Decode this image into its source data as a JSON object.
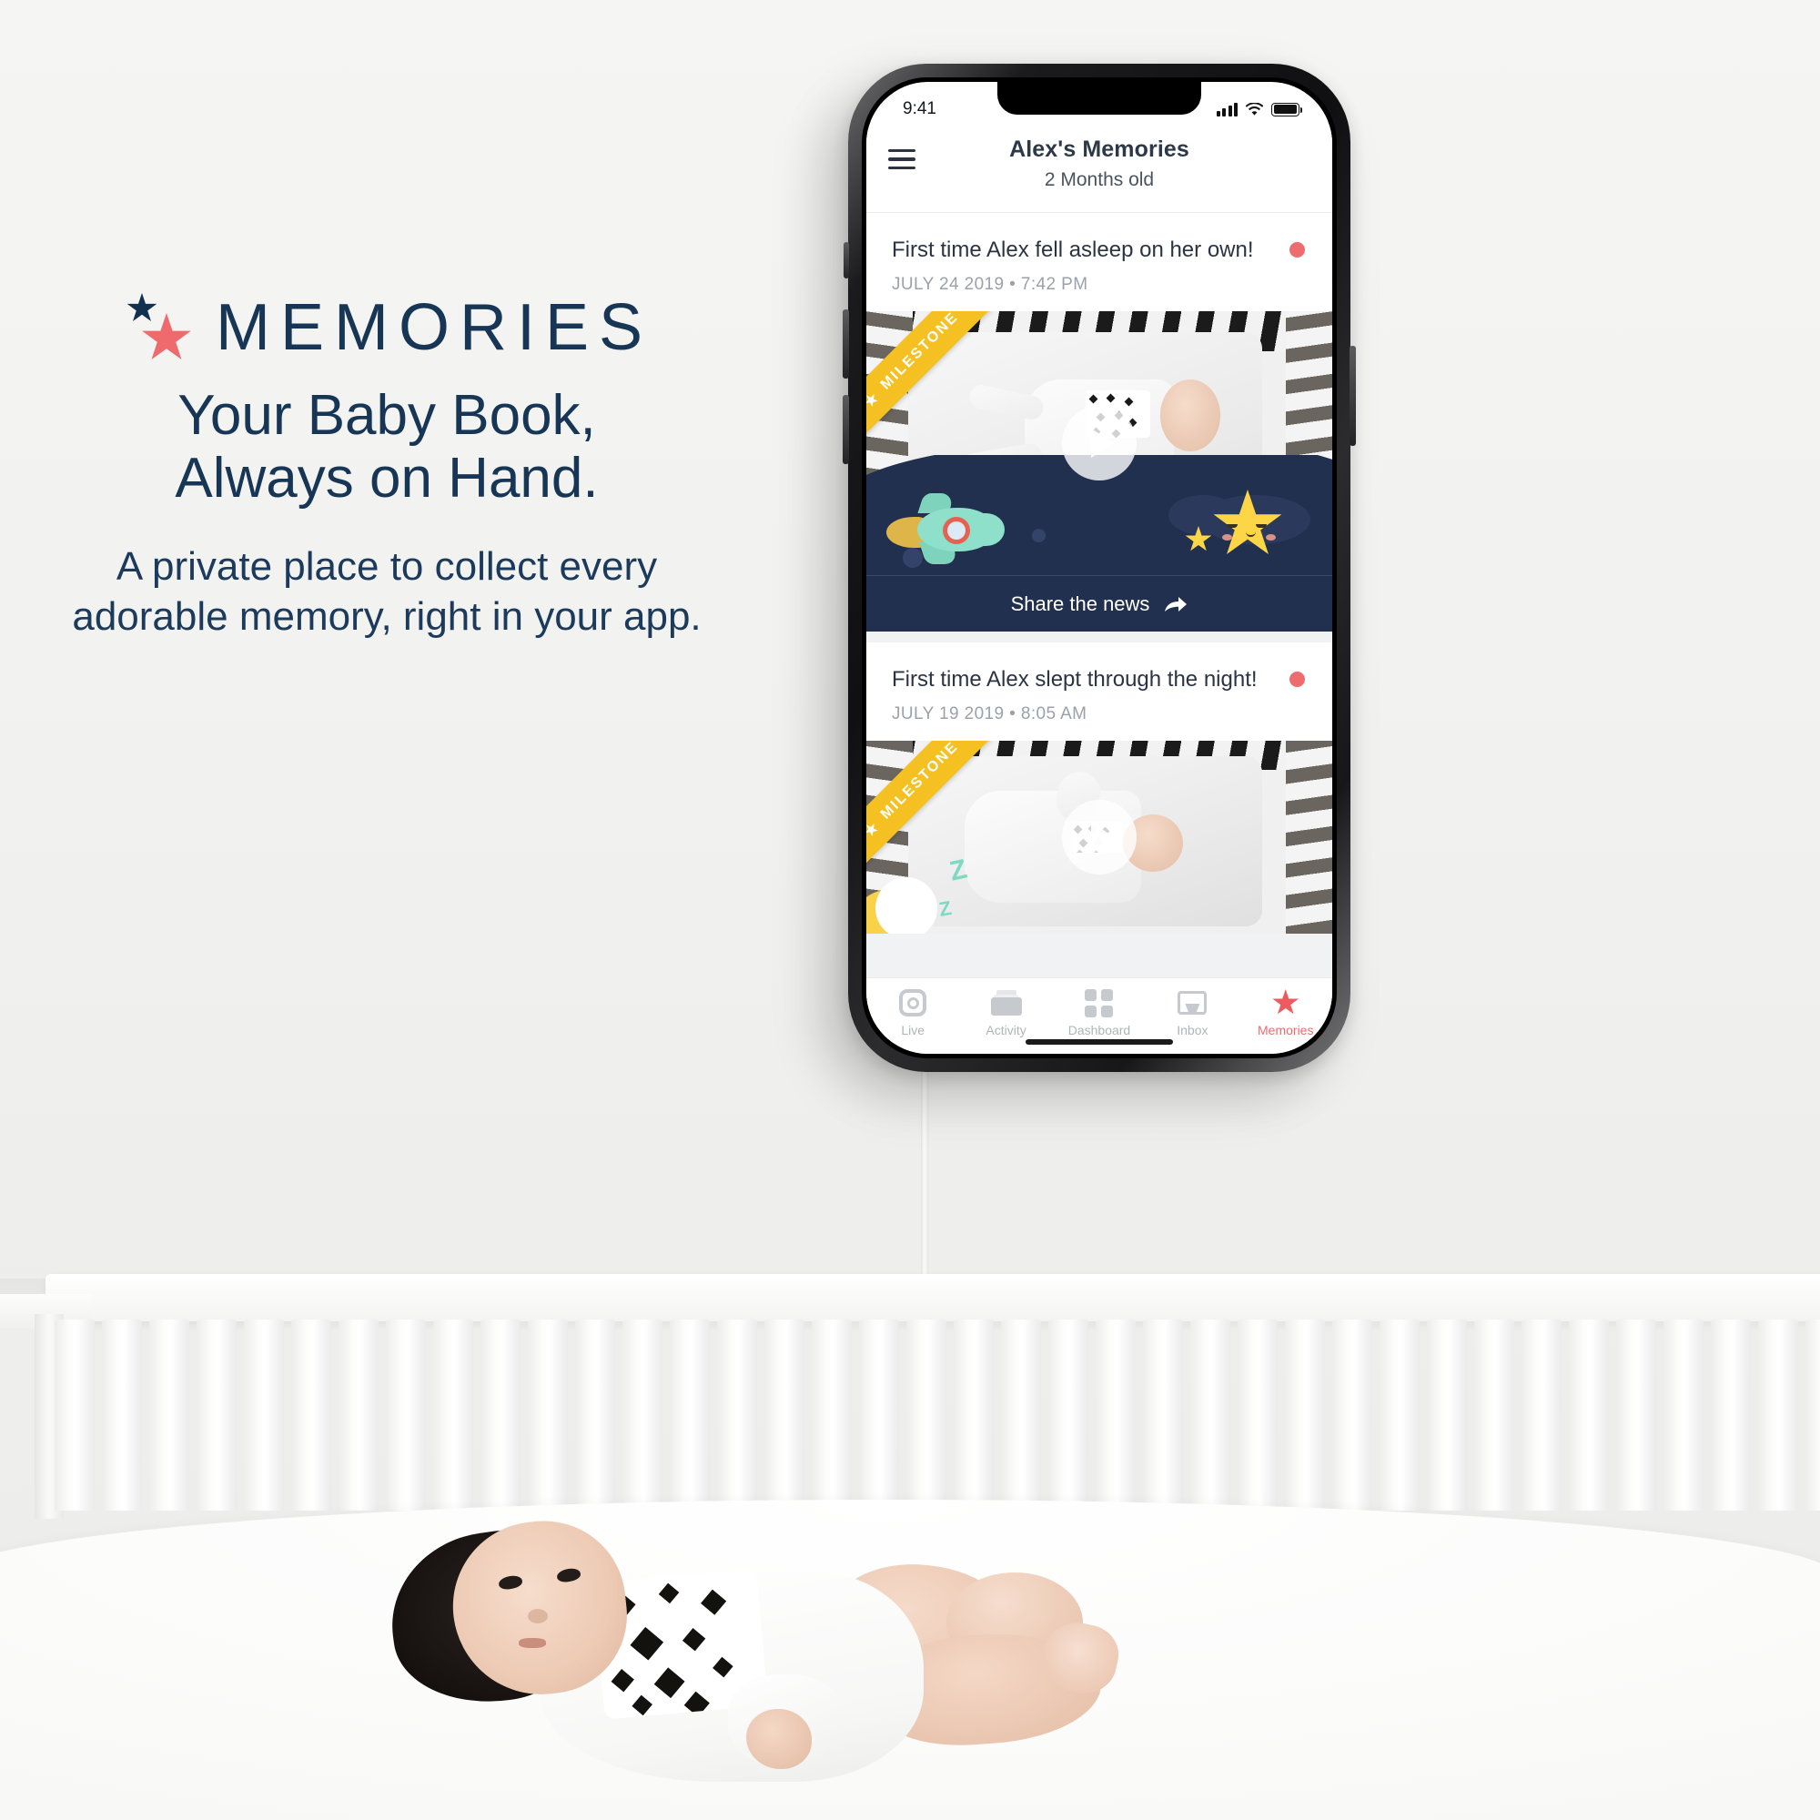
{
  "marketing": {
    "brand_word": "MEMORIES",
    "headline_line1": "Your Baby Book,",
    "headline_line2": "Always on Hand.",
    "subcopy_line1": "A private place to collect every",
    "subcopy_line2": "adorable memory, right in your app.",
    "accent_navy": "#173656",
    "accent_coral": "#ef6a6d"
  },
  "phone": {
    "statusbar": {
      "time": "9:41",
      "signal_icon": "cellular-signal-icon",
      "wifi_icon": "wifi-icon",
      "battery_icon": "battery-full-icon"
    },
    "header": {
      "menu_icon": "hamburger-menu-icon",
      "title": "Alex's Memories",
      "subtitle": "2 Months old"
    },
    "cards": [
      {
        "title": "First time Alex fell asleep on her own!",
        "date": "JULY 24 2019 • 7:42 PM",
        "ribbon": "MILESTONE",
        "dot_color": "#ee6b6e",
        "play_icon": "play-button-icon",
        "share_label": "Share the news",
        "share_icon": "share-arrow-icon"
      },
      {
        "title": "First time Alex slept through the night!",
        "date": "JULY 19 2019 • 8:05 AM",
        "ribbon": "MILESTONE",
        "dot_color": "#ee6b6e",
        "play_icon": "play-button-icon",
        "zzz_big": "Z",
        "zzz_small": "Z"
      }
    ],
    "tabbar": {
      "items": [
        {
          "label": "Live",
          "icon": "live-camera-icon",
          "active": false
        },
        {
          "label": "Activity",
          "icon": "activity-files-icon",
          "active": false
        },
        {
          "label": "Dashboard",
          "icon": "dashboard-grid-icon",
          "active": false
        },
        {
          "label": "Inbox",
          "icon": "inbox-tray-icon",
          "active": false
        },
        {
          "label": "Memories",
          "icon": "star-icon",
          "active": true
        }
      ],
      "active_color": "#ee5a5e",
      "inactive_color": "#b0b4ba"
    }
  }
}
